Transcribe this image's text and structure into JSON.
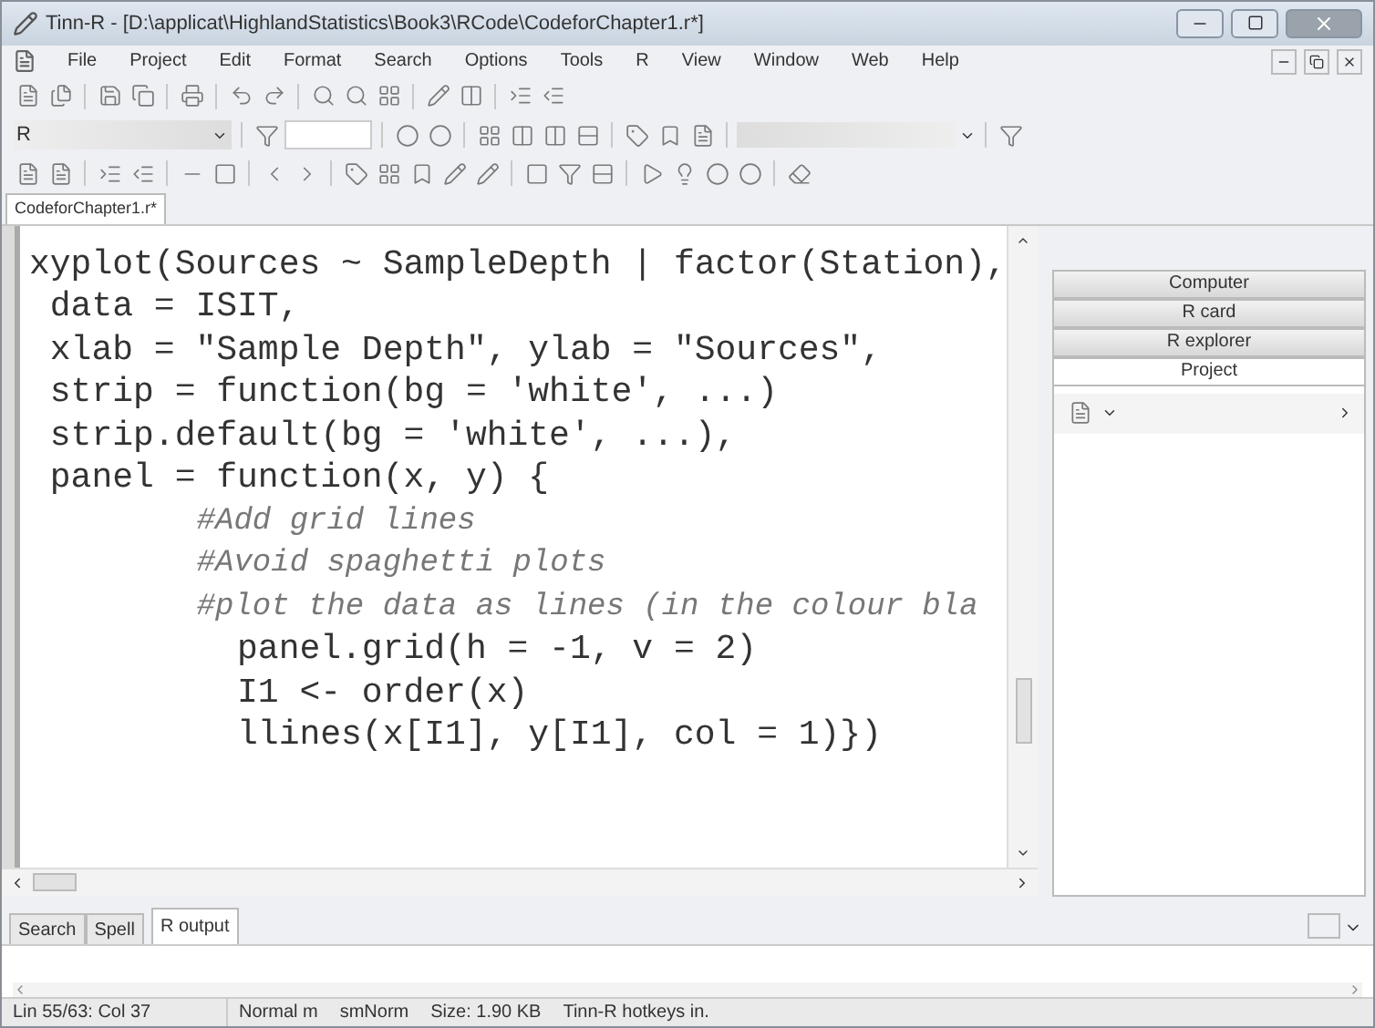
{
  "window": {
    "title": "Tinn-R - [D:\\applicat\\HighlandStatistics\\Book3\\RCode\\CodeforChapter1.r*]"
  },
  "menu": [
    "File",
    "Project",
    "Edit",
    "Format",
    "Search",
    "Options",
    "Tools",
    "R",
    "View",
    "Window",
    "Web",
    "Help"
  ],
  "toolbar": {
    "combo": "R"
  },
  "editor_tabs": [
    {
      "label": "CodeforChapter1.r*",
      "selected": true
    }
  ],
  "code_lines": [
    {
      "kind": "code",
      "text": "xyplot(Sources ~ SampleDepth | factor(Station),"
    },
    {
      "kind": "code",
      "text": " data = ISIT,"
    },
    {
      "kind": "code",
      "text": " xlab = \"Sample Depth\", ylab = \"Sources\","
    },
    {
      "kind": "code",
      "text": " strip = function(bg = 'white', ...)"
    },
    {
      "kind": "code",
      "text": " strip.default(bg = 'white', ...),"
    },
    {
      "kind": "code",
      "text": " panel = function(x, y) {"
    },
    {
      "kind": "comment",
      "text": "         #Add grid lines"
    },
    {
      "kind": "comment",
      "text": "         #Avoid spaghetti plots"
    },
    {
      "kind": "comment",
      "text": "         #plot the data as lines (in the colour bla"
    },
    {
      "kind": "code",
      "text": "          panel.grid(h = -1, v = 2)"
    },
    {
      "kind": "code",
      "text": "          I1 <- order(x)"
    },
    {
      "kind": "code",
      "text": "          llines(x[I1], y[I1], col = 1)})"
    }
  ],
  "side_tabs": [
    {
      "label": "Computer",
      "selected": false
    },
    {
      "label": "R card",
      "selected": false
    },
    {
      "label": "R explorer",
      "selected": false
    },
    {
      "label": "Project",
      "selected": true
    }
  ],
  "bottom_tabs": [
    {
      "label": "Search",
      "selected": false
    },
    {
      "label": "Spell",
      "selected": false
    },
    {
      "label": "R output",
      "selected": true
    }
  ],
  "status_bar": [
    "Lin 55/63: Col 37",
    "Normal m",
    "smNorm",
    "Size: 1.90 KB",
    "Tinn-R hotkeys in."
  ]
}
